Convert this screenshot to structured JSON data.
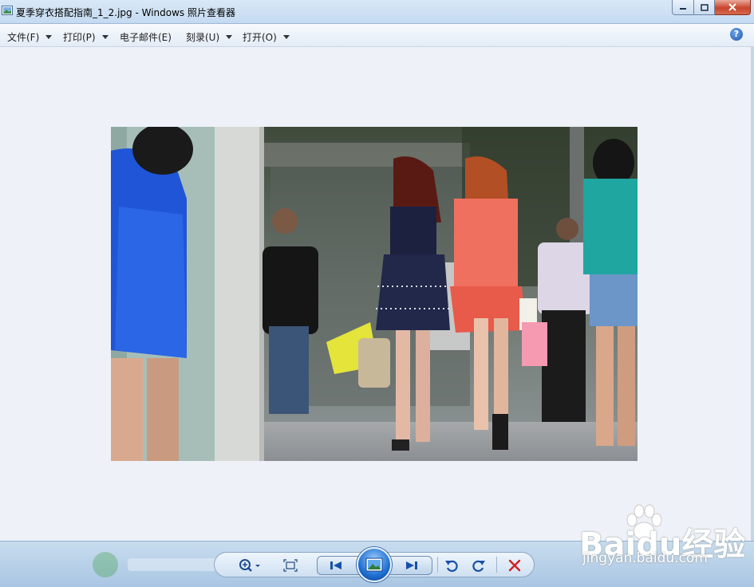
{
  "window": {
    "title": "夏季穿衣搭配指南_1_2.jpg - Windows 照片查看器"
  },
  "menu": {
    "items": [
      {
        "label": "文件(F)"
      },
      {
        "label": "打印(P)"
      },
      {
        "label": "电子邮件(E)"
      },
      {
        "label": "刻录(U)"
      },
      {
        "label": "打开(O)"
      }
    ],
    "help": "?"
  },
  "toolbar": {
    "icons": [
      "zoom-icon",
      "fit-window-icon",
      "previous-icon",
      "slideshow-icon",
      "next-icon",
      "rotate-ccw-icon",
      "rotate-cw-icon",
      "delete-icon"
    ]
  },
  "watermark": {
    "brand": "Baidu经验",
    "url": "jingyan.baidu.com"
  },
  "colors": {
    "titlebar": "#c4daf1",
    "close_button": "#c8452c",
    "viewer_background": "#eef2f8",
    "delete_icon": "#d41f1f"
  }
}
